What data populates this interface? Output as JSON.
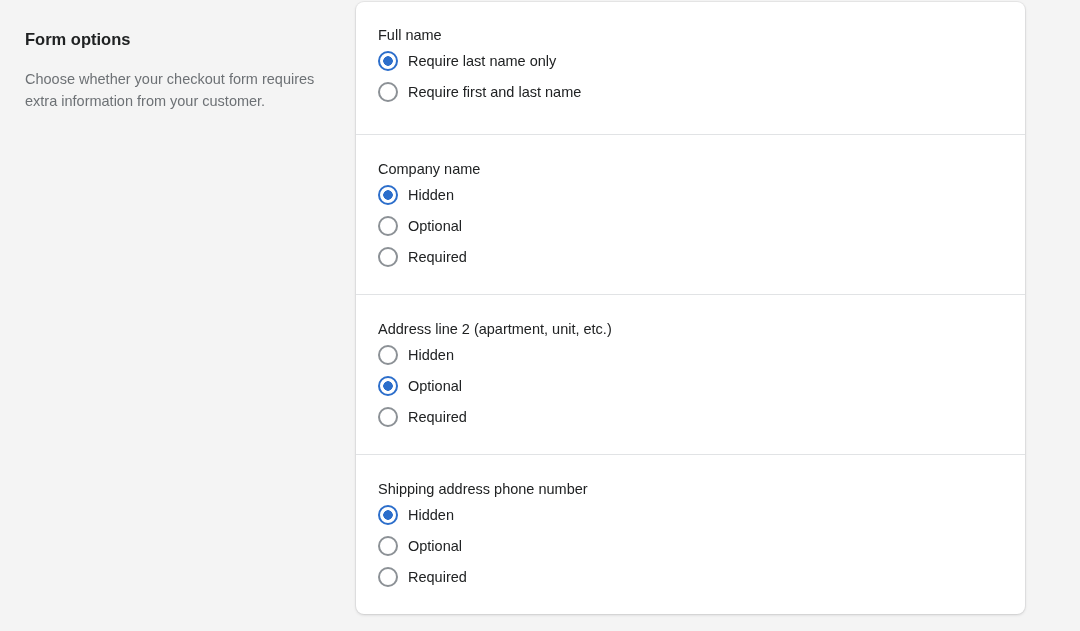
{
  "intro": {
    "title": "Form options",
    "description": "Choose whether your checkout form requires extra information from your customer."
  },
  "sections": [
    {
      "label": "Full name",
      "options": [
        {
          "label": "Require last name only",
          "selected": true
        },
        {
          "label": "Require first and last name",
          "selected": false
        }
      ]
    },
    {
      "label": "Company name",
      "options": [
        {
          "label": "Hidden",
          "selected": true
        },
        {
          "label": "Optional",
          "selected": false
        },
        {
          "label": "Required",
          "selected": false
        }
      ]
    },
    {
      "label": "Address line 2 (apartment, unit, etc.)",
      "options": [
        {
          "label": "Hidden",
          "selected": false
        },
        {
          "label": "Optional",
          "selected": true
        },
        {
          "label": "Required",
          "selected": false
        }
      ]
    },
    {
      "label": "Shipping address phone number",
      "options": [
        {
          "label": "Hidden",
          "selected": true
        },
        {
          "label": "Optional",
          "selected": false
        },
        {
          "label": "Required",
          "selected": false
        }
      ]
    }
  ]
}
